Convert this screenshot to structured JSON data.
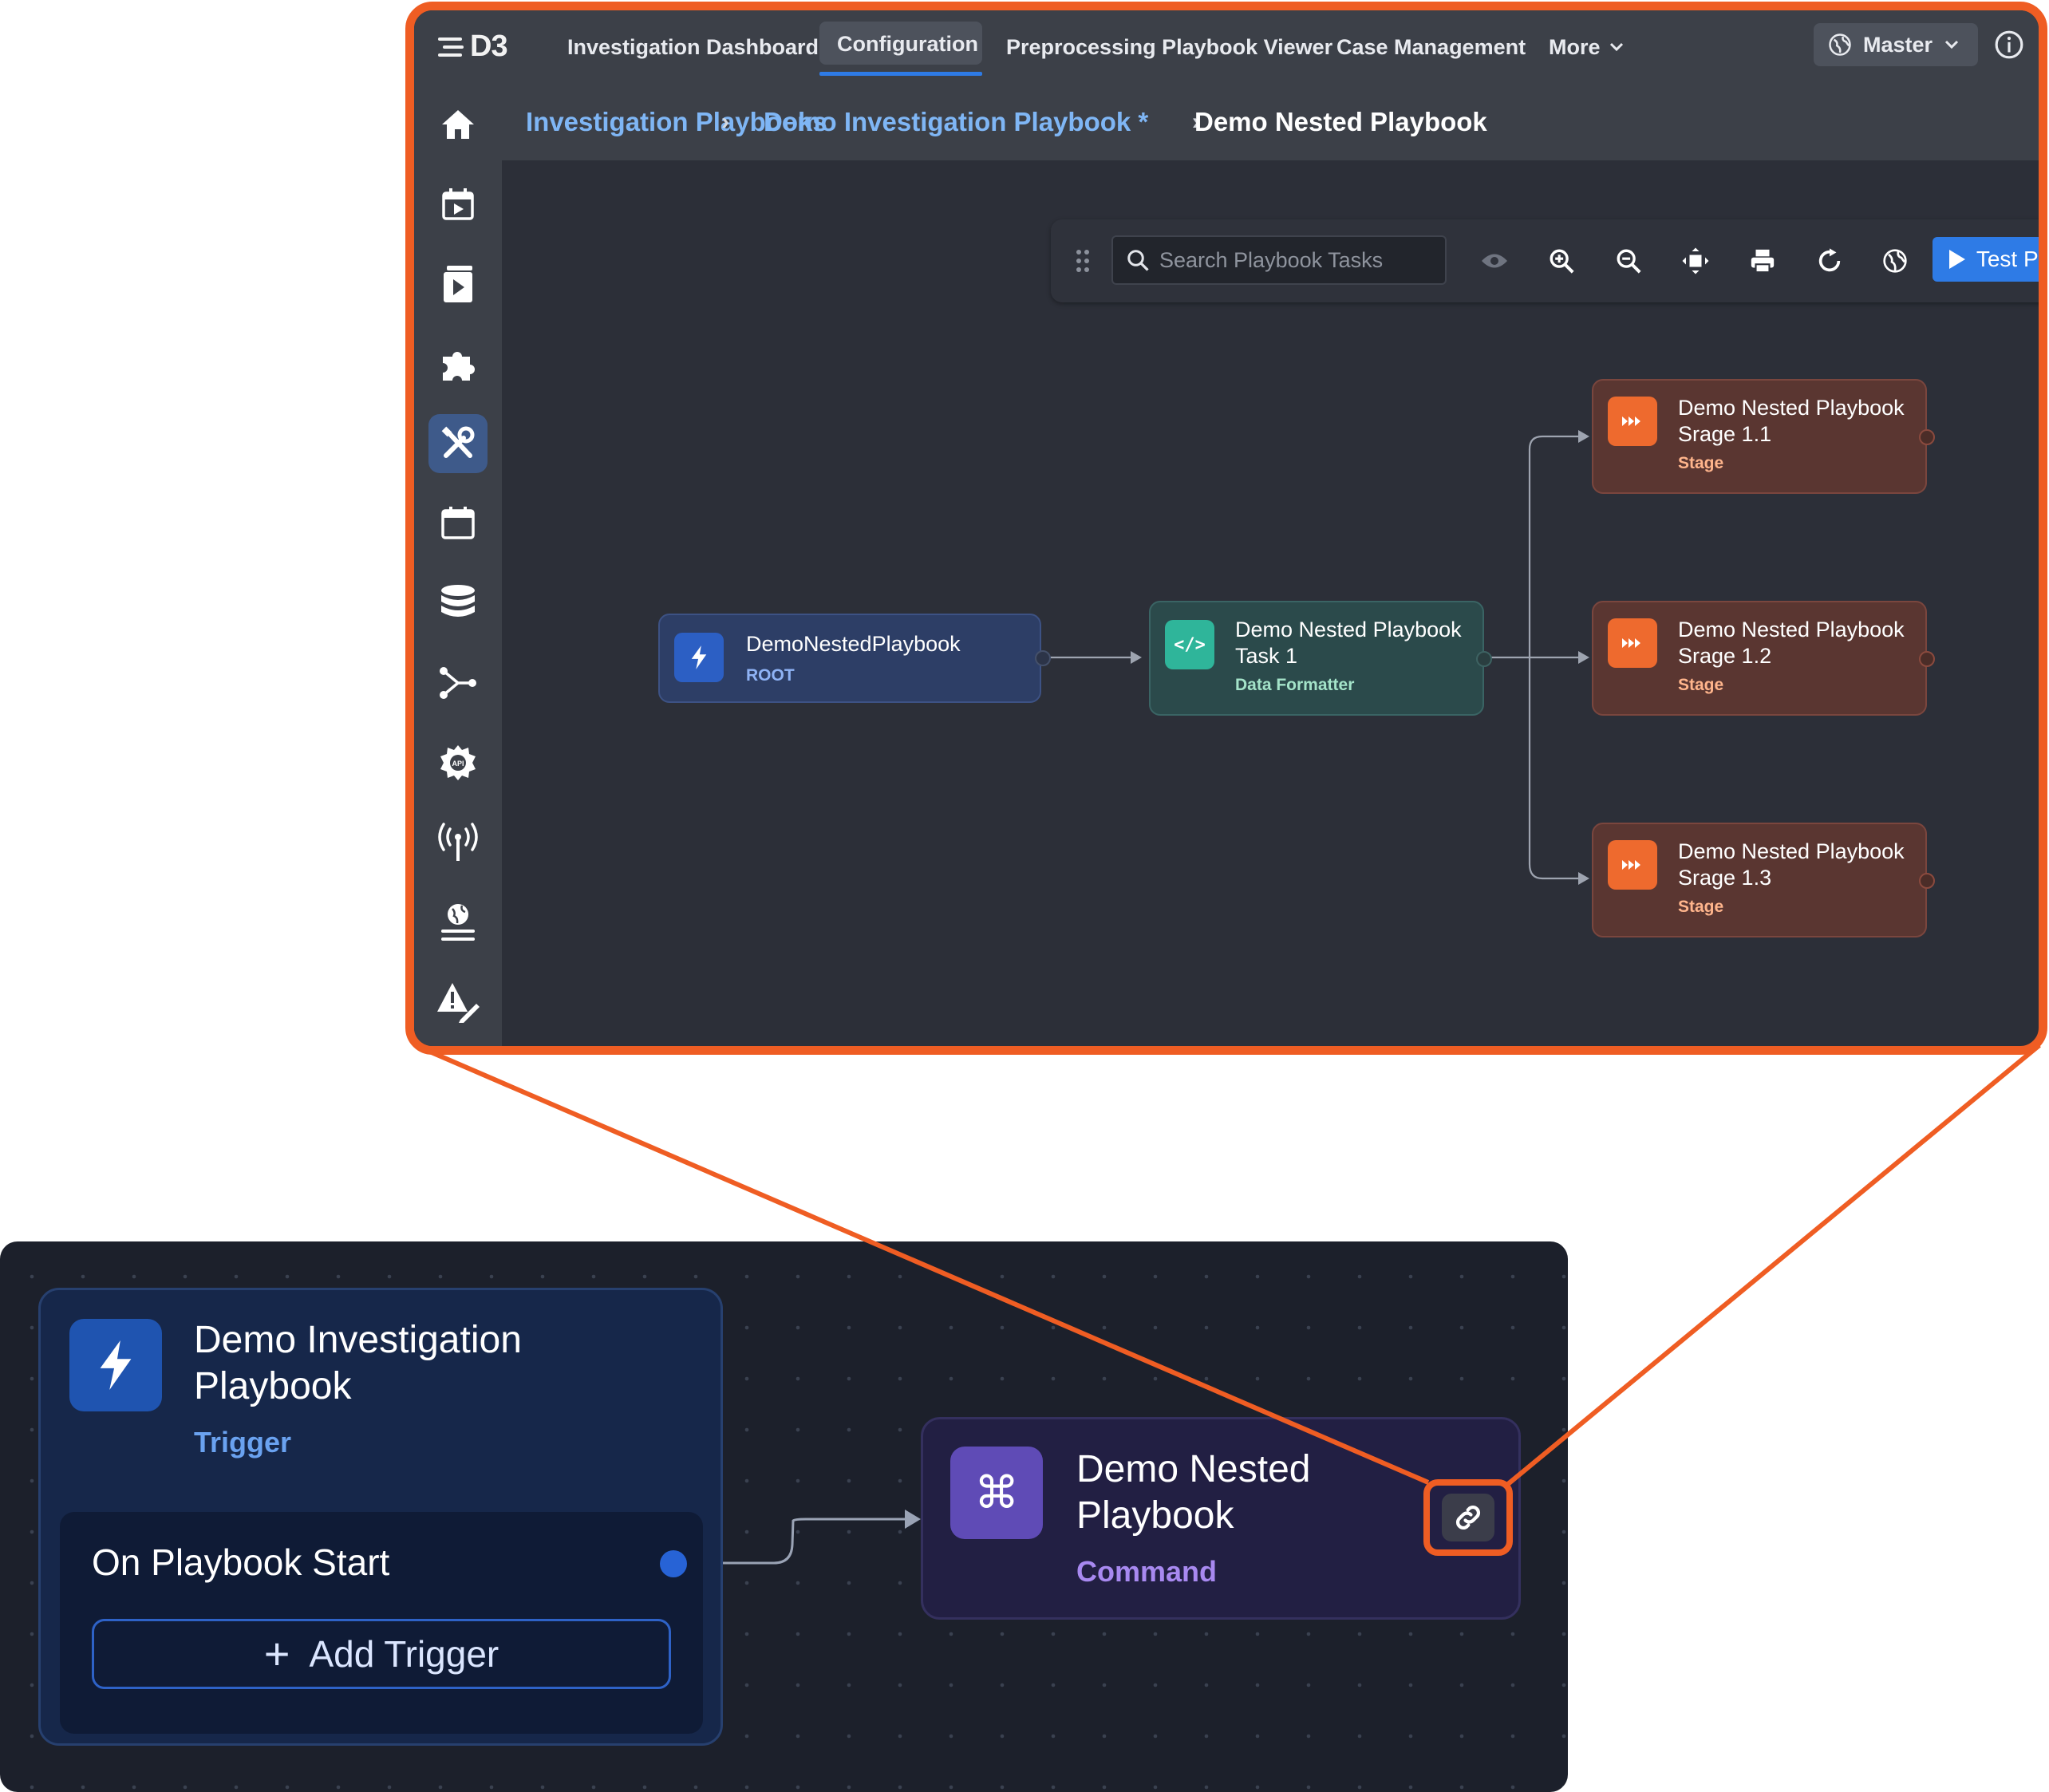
{
  "app": {
    "logo_text": "D3",
    "nav_tabs": [
      {
        "label": "Investigation Dashboard"
      },
      {
        "label": "Configuration"
      },
      {
        "label": "Preprocessing Playbook Viewer"
      },
      {
        "label": "Case Management"
      },
      {
        "label": "More"
      }
    ],
    "active_tab": "Configuration",
    "site_selector": "Master"
  },
  "breadcrumb": {
    "items": [
      "Investigation Playbooks",
      "Demo Investigation Playbook *",
      "Demo Nested Playbook"
    ]
  },
  "toolbar": {
    "search_placeholder": "Search Playbook Tasks",
    "test_button": "Test Playbook"
  },
  "nested_flow": {
    "root": {
      "title": "DemoNestedPlaybook",
      "type": "ROOT"
    },
    "task": {
      "title_line1": "Demo Nested Playbook",
      "title_line2": "Task 1",
      "type": "Data Formatter"
    },
    "stages": [
      {
        "title_line1": "Demo Nested Playbook",
        "title_line2": "Srage 1.1",
        "type": "Stage"
      },
      {
        "title_line1": "Demo Nested Playbook",
        "title_line2": "Srage 1.2",
        "type": "Stage"
      },
      {
        "title_line1": "Demo Nested Playbook",
        "title_line2": "Srage 1.3",
        "type": "Stage"
      }
    ]
  },
  "parent_flow": {
    "trigger_node": {
      "title_line1": "Demo Investigation",
      "title_line2": "Playbook",
      "type": "Trigger"
    },
    "trigger_event": "On Playbook Start",
    "add_trigger": "Add Trigger",
    "command_node": {
      "title_line1": "Demo Nested",
      "title_line2": "Playbook",
      "type": "Command"
    }
  },
  "colors": {
    "highlight": "#ef5d23",
    "nav_bg": "#3c4048",
    "canvas_bg": "#2c2f38",
    "accent_blue": "#2e7be6",
    "root_node": "#2d3e66",
    "task_node": "#2b4a4b",
    "stage_node": "#5a3631",
    "stage_icon": "#ee6a2e",
    "bottom_canvas": "#1c202b",
    "trigger_node": "#16274a",
    "command_node": "#221f43",
    "command_icon": "#5f4bb6"
  },
  "icons": {
    "sidebar": [
      "home-icon",
      "events-icon",
      "playbook-icon",
      "integrations-icon",
      "configuration-tools-icon",
      "calendar-icon",
      "database-icon",
      "graph-icon",
      "api-settings-icon",
      "broadcast-icon",
      "global-settings-icon",
      "alert-edit-icon"
    ],
    "toolbar": [
      "drag-handle-icon",
      "search-icon",
      "eye-icon",
      "zoom-in-icon",
      "zoom-out-icon",
      "fit-view-icon",
      "print-icon",
      "refresh-icon",
      "globe-icon",
      "play-icon"
    ],
    "nodes": [
      "bolt-icon",
      "code-icon",
      "stage-icon",
      "command-icon",
      "link-icon",
      "plus-icon"
    ]
  }
}
